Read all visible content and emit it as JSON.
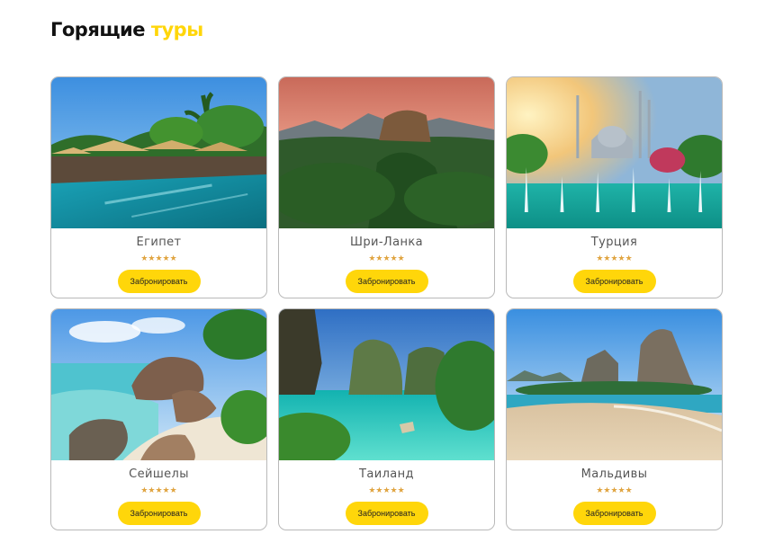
{
  "heading": {
    "part1": "Горящие",
    "part2": "туры"
  },
  "accent_color": "#ffd60a",
  "tours": [
    {
      "name": "Египет",
      "stars": "★★★★★",
      "button": "Забронировать"
    },
    {
      "name": "Шри-Ланка",
      "stars": "★★★★★",
      "button": "Забронировать"
    },
    {
      "name": "Турция",
      "stars": "★★★★★",
      "button": "Забронировать"
    },
    {
      "name": "Сейшелы",
      "stars": "★★★★★",
      "button": "Забронировать"
    },
    {
      "name": "Таиланд",
      "stars": "★★★★★",
      "button": "Забронировать"
    },
    {
      "name": "Мальдивы",
      "stars": "★★★★★",
      "button": "Забронировать"
    }
  ]
}
